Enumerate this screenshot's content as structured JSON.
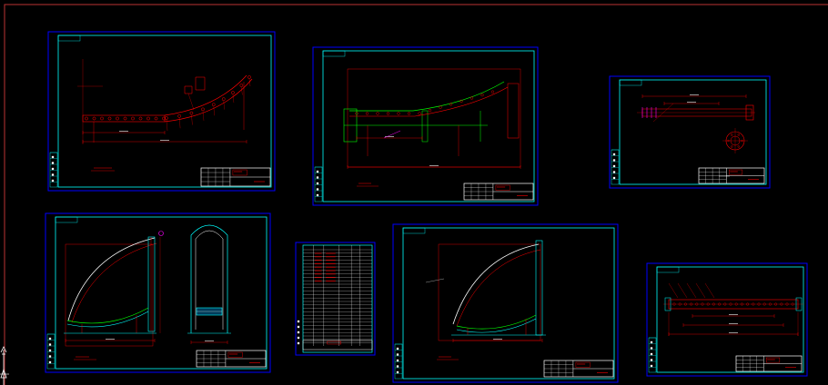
{
  "app": {
    "view": "CAD model space"
  },
  "colors": {
    "background": "#000000",
    "frame": "#0000ff",
    "border": "#00ffff",
    "geometry": "#ff0000",
    "title_block": "#ffffff",
    "crosshair": "#ffffff",
    "axis": "#cc3333",
    "highlight": "#ff00ff",
    "green": "#00ff00",
    "yellow": "#ffff00"
  },
  "icons": {
    "ucs": "ucs-axis-icon",
    "crosshair": "crosshair-icon"
  },
  "sheets": [
    {
      "id": "roller-curve-elevation",
      "kind": "roller-curve"
    },
    {
      "id": "curved-frame-elevation",
      "kind": "frame-curve"
    },
    {
      "id": "single-roller-detail",
      "kind": "roller-detail"
    },
    {
      "id": "arched-cover-elevation",
      "kind": "arc-cover"
    },
    {
      "id": "parts-list",
      "kind": "bom"
    },
    {
      "id": "arched-cover-assembly",
      "kind": "arc-single"
    },
    {
      "id": "straight-roller-detail",
      "kind": "long-roller"
    }
  ]
}
